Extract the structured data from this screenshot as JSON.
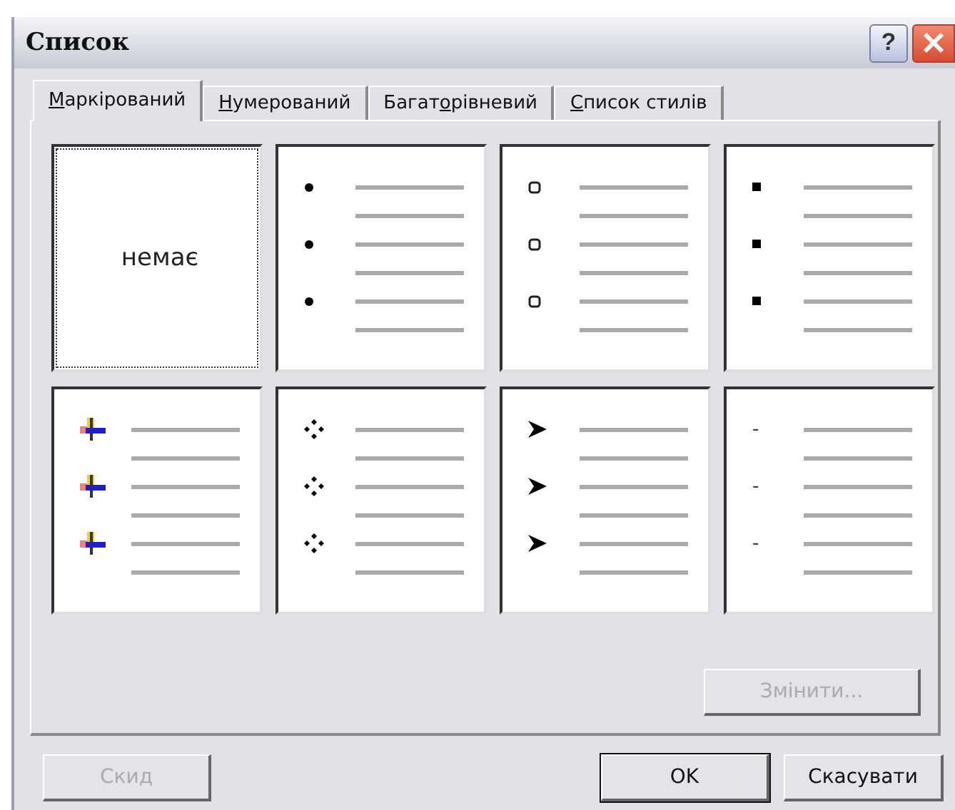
{
  "window": {
    "title": "Список",
    "help": "?"
  },
  "tabs": [
    {
      "key": "М",
      "after": "аркірований",
      "selected": true
    },
    {
      "key": "Н",
      "after": "умерований",
      "selected": false
    },
    {
      "before": "Багат",
      "key": "о",
      "after": "рівневий",
      "selected": false
    },
    {
      "key": "С",
      "after": "писок стилів",
      "selected": false
    }
  ],
  "styles": [
    {
      "kind": "none",
      "label": "немає",
      "selected": true
    },
    {
      "kind": "dot",
      "selected": false
    },
    {
      "kind": "circle",
      "selected": false
    },
    {
      "kind": "square",
      "selected": false
    },
    {
      "kind": "picture",
      "selected": false
    },
    {
      "kind": "diamonds",
      "selected": false
    },
    {
      "kind": "arrowhead",
      "selected": false
    },
    {
      "kind": "dash",
      "label": "-",
      "selected": false
    }
  ],
  "change_button": {
    "label": "Змінити...",
    "disabled": true
  },
  "buttons": [
    {
      "label": "Скид",
      "disabled": true,
      "default": false
    },
    {
      "label": "OK",
      "disabled": false,
      "default": true
    },
    {
      "label": "Скасувати",
      "disabled": false,
      "default": false
    }
  ]
}
